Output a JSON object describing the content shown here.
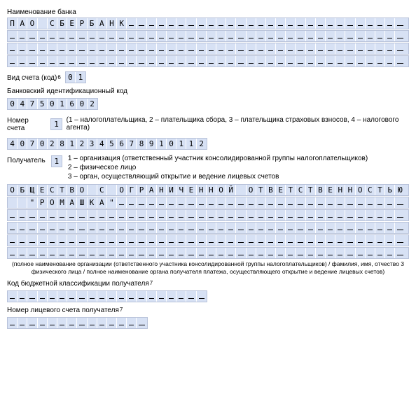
{
  "labels": {
    "bank_name": "Наименование банка",
    "account_type": "Вид счета (код)",
    "account_type_sup": "6",
    "bik": "Банковский идентификационный код",
    "account_num": "Номер счета",
    "account_num_paren": "(1 – налогоплательщика, 2 – плательщика сбора, 3 – плательщика страховых взносов, 4 – налогового агента)",
    "recipient": "Получатель",
    "recipient_lines": {
      "l1": "1 – организация (ответственный участник консолидированной группы налогоплательщиков)",
      "l2": "2 – физическое лицо",
      "l3": "3 – орган, осуществляющий открытие и ведение лицевых счетов"
    },
    "footnote": "(полное наименование организации (ответственного участника консолидированной группы налогоплательщиков) / фамилия, имя, отчество 3 физического лица / полное наименование органа получателя платежа, осуществляющего открытие и ведение лицевых счетов)",
    "kbk": "Код бюджетной классификации получателя",
    "kbk_sup": "7",
    "pers_acc": "Номер лицевого счета получателя",
    "pers_acc_sup": "7"
  },
  "values": {
    "bank_name": "ПАО СБЕРБАНК",
    "account_type": "01",
    "bik": "047501602",
    "account_num_code": "1",
    "account_20": "40702812345678910112",
    "recipient_code": "1",
    "recipient_name_l1": "ОБЩЕСТВО С ОГРАНИЧЕННОЙ ОТВЕТСТВЕННОСТЬЮ",
    "recipient_name_l2": "  \"РОМАШКА\"",
    "kbk": "",
    "pers_acc": ""
  },
  "widths": {
    "full": 40,
    "bank_rows": 4,
    "recip_rows": 6,
    "bik": 9,
    "acc_type": 2,
    "acc20": 20,
    "kbk": 20,
    "pers": 14,
    "code1": 1
  }
}
